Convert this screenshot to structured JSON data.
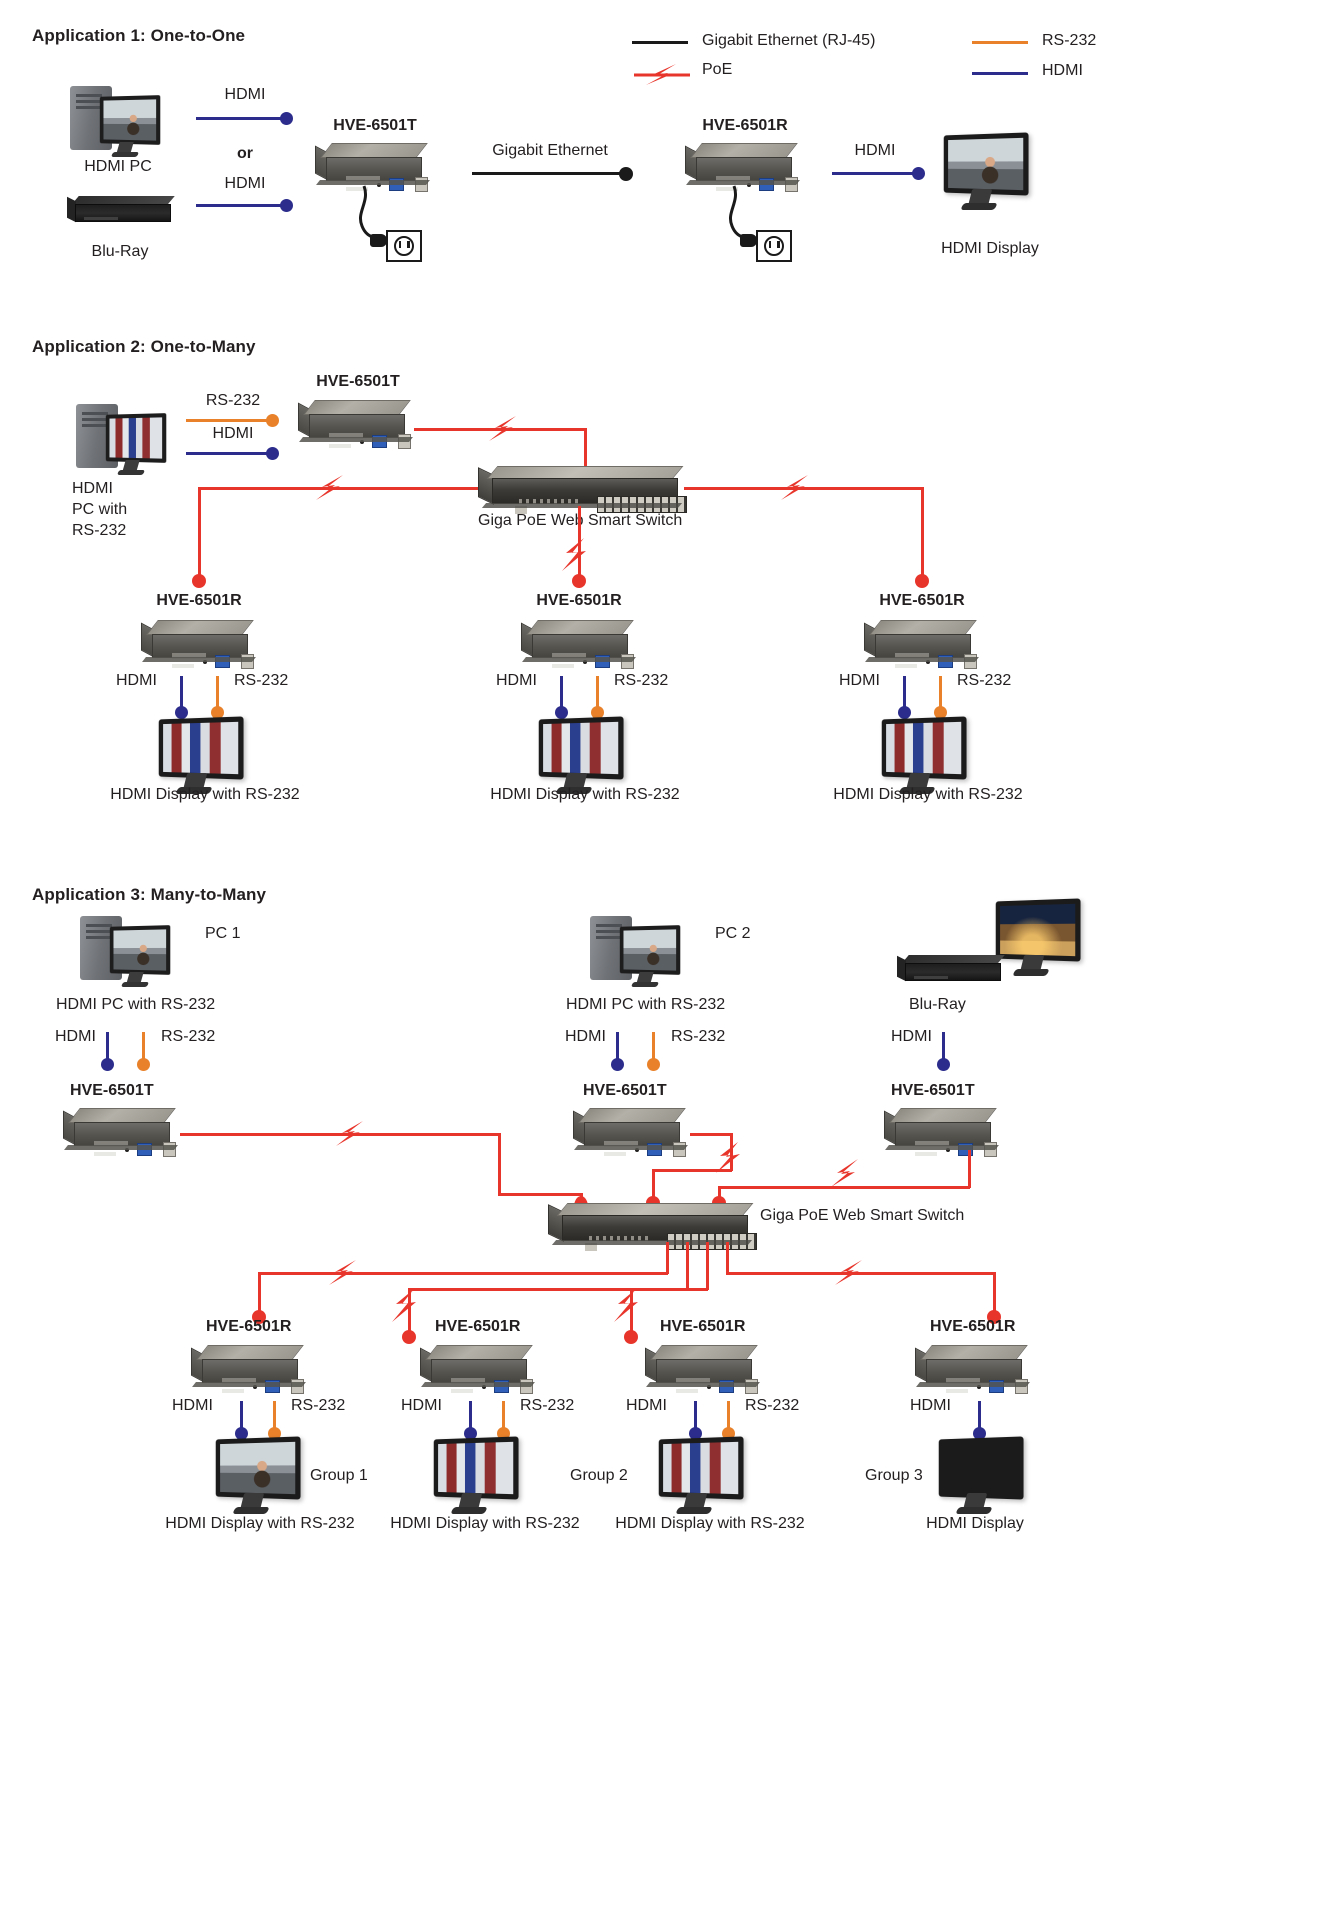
{
  "legend": {
    "items": [
      {
        "label": "Gigabit Ethernet (RJ-45)",
        "color": "#1a1a1a",
        "icon": "line-solid-icon"
      },
      {
        "label": "RS-232",
        "color": "#e8812a",
        "icon": "line-solid-icon"
      },
      {
        "label": "PoE",
        "color": "#e8352b",
        "icon": "lightning-bolt-icon"
      },
      {
        "label": "HDMI",
        "color": "#2b2c8c",
        "icon": "line-solid-icon"
      }
    ]
  },
  "colors": {
    "hdmi": "#2b2c8c",
    "rs232": "#e8812a",
    "poe": "#e8352b",
    "ethernet": "#1a1a1a",
    "text": "#231f20",
    "background": "#ffffff"
  },
  "app1": {
    "title": "Application 1: One-to-One",
    "source_pc_label": "HDMI PC",
    "source_bluray_label": "Blu-Ray",
    "link_hdmi_top": "HDMI",
    "or_label": "or",
    "link_hdmi_bottom": "HDMI",
    "transmitter": "HVE-6501T",
    "link_ethernet": "Gigabit Ethernet",
    "receiver": "HVE-6501R",
    "link_hdmi_out": "HDMI",
    "display_label": "HDMI Display"
  },
  "app2": {
    "title": "Application 2: One-to-Many",
    "source_label_lines": [
      "HDMI",
      "PC with",
      "RS-232"
    ],
    "link_rs232": "RS-232",
    "link_hdmi": "HDMI",
    "transmitter": "HVE-6501T",
    "switch_label": "Giga PoE Web Smart Switch",
    "receivers": [
      {
        "name": "HVE-6501R",
        "hdmi_label": "HDMI",
        "rs232_label": "RS-232",
        "display_label": "HDMI Display with RS-232"
      },
      {
        "name": "HVE-6501R",
        "hdmi_label": "HDMI",
        "rs232_label": "RS-232",
        "display_label": "HDMI Display with RS-232"
      },
      {
        "name": "HVE-6501R",
        "hdmi_label": "HDMI",
        "rs232_label": "RS-232",
        "display_label": "HDMI Display with RS-232"
      }
    ]
  },
  "app3": {
    "title": "Application 3:  Many-to-Many",
    "sources": [
      {
        "tag": "PC 1",
        "caption": "HDMI PC with RS-232",
        "hdmi_label": "HDMI",
        "rs232_label": "RS-232",
        "transmitter": "HVE-6501T"
      },
      {
        "tag": "PC 2",
        "caption": "HDMI PC with RS-232",
        "hdmi_label": "HDMI",
        "rs232_label": "RS-232",
        "transmitter": "HVE-6501T"
      },
      {
        "tag": "",
        "caption": "Blu-Ray",
        "hdmi_label": "HDMI",
        "rs232_label": "",
        "transmitter": "HVE-6501T"
      }
    ],
    "switch_label": "Giga PoE Web Smart Switch",
    "receivers": [
      {
        "name": "HVE-6501R",
        "hdmi_label": "HDMI",
        "rs232_label": "RS-232",
        "group": "Group 1",
        "display_label": "HDMI Display with RS-232"
      },
      {
        "name": "HVE-6501R",
        "hdmi_label": "HDMI",
        "rs232_label": "RS-232",
        "group": "Group 2",
        "display_label": "HDMI Display with RS-232"
      },
      {
        "name": "HVE-6501R",
        "hdmi_label": "HDMI",
        "rs232_label": "RS-232",
        "group": "",
        "display_label": "HDMI Display with RS-232"
      },
      {
        "name": "HVE-6501R",
        "hdmi_label": "HDMI",
        "rs232_label": "",
        "group": "Group 3",
        "display_label": "HDMI Display"
      }
    ]
  }
}
